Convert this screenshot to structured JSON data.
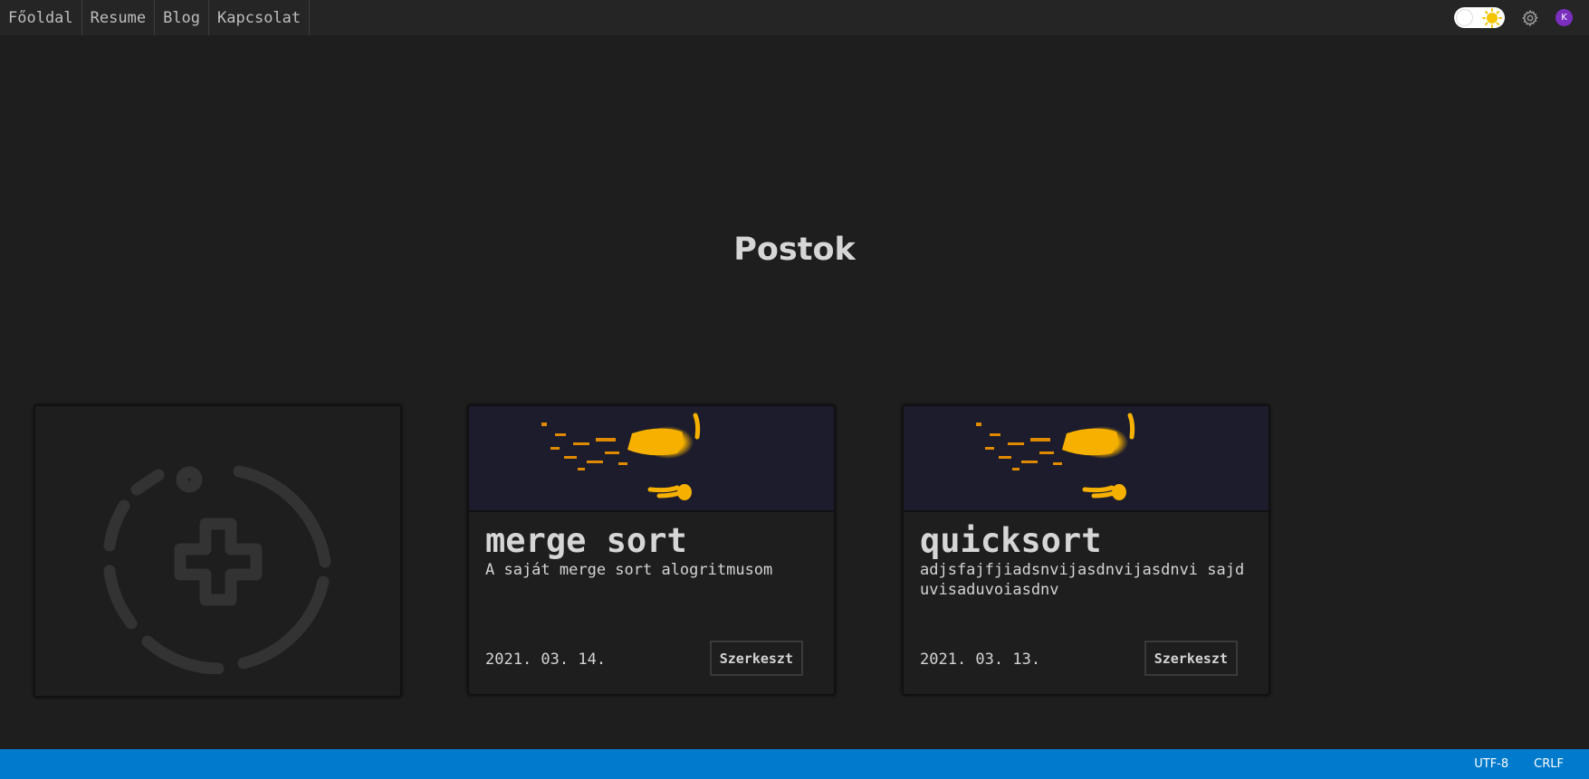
{
  "nav": {
    "tabs": [
      {
        "label": "Főoldal"
      },
      {
        "label": "Resume"
      },
      {
        "label": "Blog"
      },
      {
        "label": "Kapcsolat"
      }
    ]
  },
  "header_right": {
    "theme_toggle_icon": "sun-icon",
    "settings_icon": "gear-icon",
    "avatar_initial": "K",
    "avatar_color": "#7b2fbf"
  },
  "main": {
    "title": "Postok",
    "new_post_icon": "add-circle-icon",
    "posts": [
      {
        "title": "merge sort",
        "description": "A saját merge sort alogritmusom",
        "date": "2021. 03. 14.",
        "edit_label": "Szerkeszt"
      },
      {
        "title": "quicksort",
        "description": "adjsfajfjiadsnvijasdnvijasdnvi sajduvisaduvoiasdnv",
        "date": "2021. 03. 13.",
        "edit_label": "Szerkeszt"
      }
    ]
  },
  "statusbar": {
    "encoding": "UTF-8",
    "line_ending": "CRLF",
    "color": "#007acc"
  }
}
